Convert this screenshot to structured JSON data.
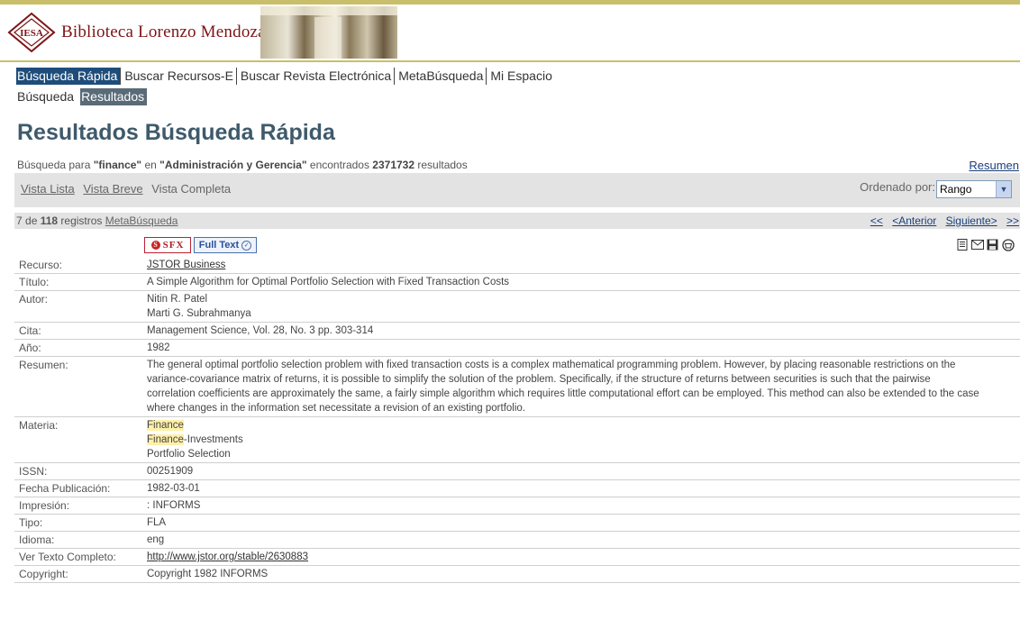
{
  "header": {
    "logo_text": "Biblioteca Lorenzo Mendoza Fleury",
    "logo_monogram": "IESA"
  },
  "nav_primary": [
    {
      "label": "Búsqueda Rápida",
      "active": true
    },
    {
      "label": "Buscar Recursos-E",
      "active": false
    },
    {
      "label": "Buscar Revista Electrónica",
      "active": false
    },
    {
      "label": "MetaBúsqueda",
      "active": false
    },
    {
      "label": "Mi Espacio",
      "active": false
    }
  ],
  "nav_secondary": [
    {
      "label": "Búsqueda",
      "active": false
    },
    {
      "label": "Resultados",
      "active": true
    }
  ],
  "page_title": "Resultados Búsqueda Rápida",
  "search_info": {
    "prefix": "Búsqueda para ",
    "query": "\"finance\"",
    "mid": " en ",
    "collection": "\"Administración y Gerencia\"",
    "found": " encontrados ",
    "count": "2371732",
    "suffix": " resultados"
  },
  "resumen_link": "Resumen",
  "views": {
    "lista": "Vista Lista",
    "breve": "Vista Breve",
    "completa": "Vista Completa"
  },
  "sort": {
    "label": "Ordenado por:",
    "value": "Rango"
  },
  "record_bar": {
    "position": "7",
    "de": " de ",
    "total": "118",
    "registros": " registros ",
    "source": "MetaBúsqueda"
  },
  "pager": {
    "first": "<<",
    "prev": "<Anterior",
    "next": "Siguiente>",
    "last": ">>"
  },
  "badges": {
    "sfx": "SFX",
    "fulltext": "Full Text"
  },
  "record": {
    "recurso": {
      "label": "Recurso:",
      "value": "JSTOR Business"
    },
    "titulo": {
      "label": "Título:",
      "value": "A Simple Algorithm for Optimal Portfolio Selection with Fixed Transaction Costs"
    },
    "autor": {
      "label": "Autor:",
      "values": [
        "Nitin R. Patel",
        "Marti G. Subrahmanya"
      ]
    },
    "cita": {
      "label": "Cita:",
      "value": "Management Science, Vol. 28, No. 3 pp. 303-314"
    },
    "anio": {
      "label": "Año:",
      "value": "1982"
    },
    "resumen": {
      "label": "Resumen:",
      "lines": [
        "The general optimal portfolio selection problem with fixed transaction costs is a complex mathematical programming problem. However, by placing reasonable restrictions on the",
        "variance-covariance matrix of returns, it is possible to simplify the solution of the problem. Specifically, if the structure of returns between securities is such that the pairwise",
        "correlation coefficients are approximately the same, a fairly simple algorithm which requires little computational effort can be employed. This method can also be extended to the case",
        "where changes in the information set necessitate a revision of an existing portfolio."
      ]
    },
    "materia": {
      "label": "Materia:",
      "items": [
        {
          "highlight": "Finance",
          "rest": ""
        },
        {
          "highlight": "Finance",
          "rest": "-Investments"
        },
        {
          "highlight": "",
          "rest": "Portfolio Selection"
        }
      ]
    },
    "issn": {
      "label": "ISSN:",
      "value": "00251909"
    },
    "fecha": {
      "label": "Fecha Publicación:",
      "value": "1982-03-01"
    },
    "impresion": {
      "label": "Impresión:",
      "value": ": INFORMS"
    },
    "tipo": {
      "label": "Tipo:",
      "value": "FLA"
    },
    "idioma": {
      "label": "Idioma:",
      "value": "eng"
    },
    "texto": {
      "label": "Ver Texto Completo:",
      "value": "http://www.jstor.org/stable/2630883"
    },
    "copyright": {
      "label": "Copyright:",
      "value": "Copyright 1982 INFORMS"
    }
  },
  "icons": [
    "list-icon",
    "mail-icon",
    "save-icon",
    "basket-icon"
  ],
  "colors": {
    "nav_active": "#1e4d7b",
    "subnav_active": "#5a6b78",
    "title": "#3e5a6b",
    "logo": "#7d1416",
    "highlight": "#fff0a8"
  }
}
